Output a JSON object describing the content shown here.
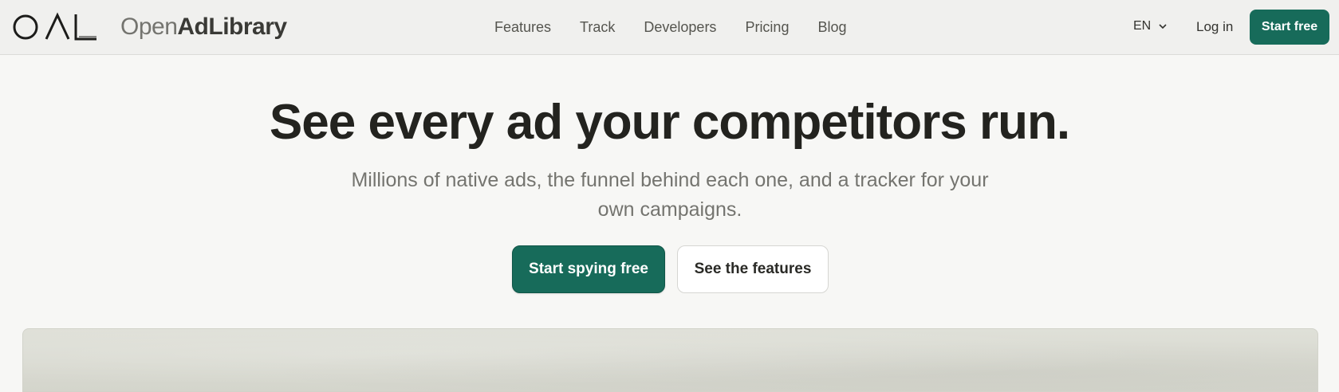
{
  "brand": {
    "mark_letters": "OAL",
    "name_light": "Open",
    "name_bold": "AdLibrary"
  },
  "nav": {
    "links": [
      "Features",
      "Track",
      "Developers",
      "Pricing",
      "Blog"
    ]
  },
  "header_actions": {
    "language": "EN",
    "language_icon": "chevron-down-icon",
    "login_label": "Log in",
    "start_free_label": "Start free"
  },
  "hero": {
    "title": "See every ad your competitors run.",
    "subtitle": "Millions of native ads, the funnel behind each one, and a tracker for your own campaigns.",
    "primary_cta": "Start spying free",
    "secondary_cta": "See the features"
  },
  "colors": {
    "accent": "#176b5a",
    "background": "#f7f7f5",
    "nav_background": "#f0f0ee",
    "muted_text": "#74746f"
  }
}
